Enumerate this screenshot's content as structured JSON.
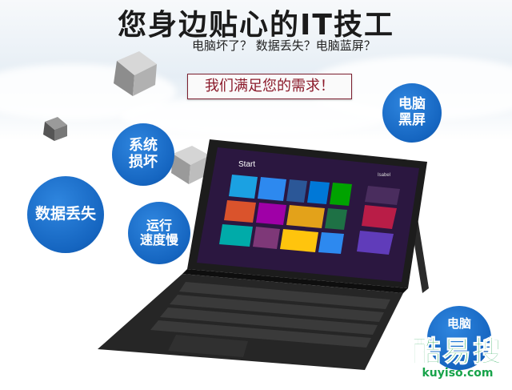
{
  "headline": "您身边贴心的IT技工",
  "subheadline": "电脑坏了？ 数据丢失？电脑蓝屏？",
  "banner": "我们满足您的需求！",
  "bubbles": {
    "black_screen": [
      "电脑",
      "黑屏"
    ],
    "system_broken": [
      "系统",
      "损坏"
    ],
    "data_loss": "数据丢失",
    "slow_speed": [
      "运行",
      "速度慢"
    ],
    "partial": "电脑"
  },
  "screen": {
    "start_label": "Start",
    "user_label": "Isabel"
  },
  "watermark": {
    "name": "酷易搜",
    "domain": "kuyiso.com"
  },
  "colors": {
    "bubble_blue": "#1565c0",
    "banner_red": "#8b1a2a",
    "watermark_green": "#17a34a"
  }
}
